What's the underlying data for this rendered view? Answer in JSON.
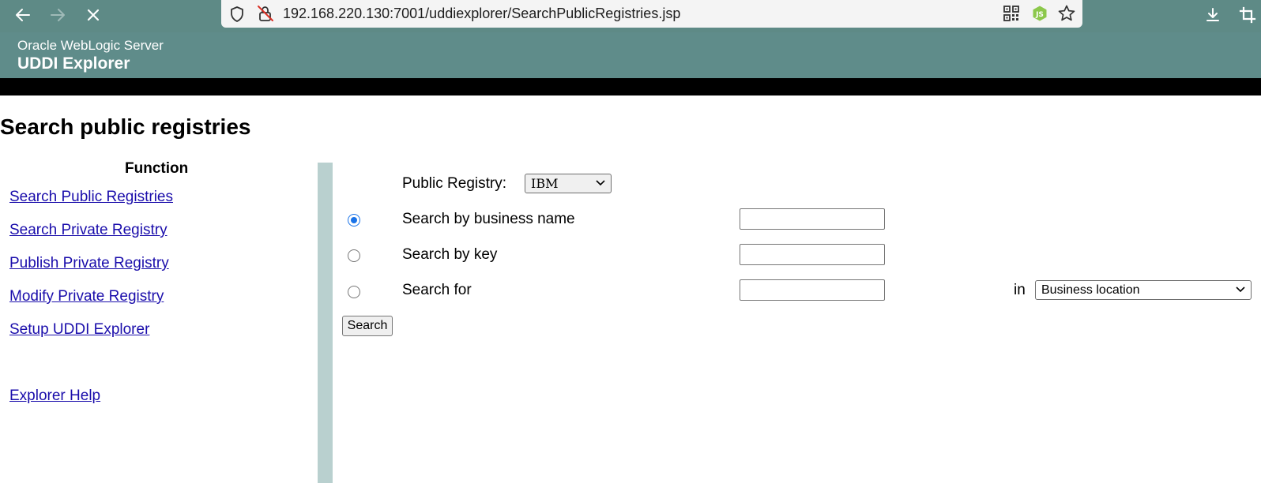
{
  "browser": {
    "url": "192.168.220.130:7001/uddiexplorer/SearchPublicRegistries.jsp",
    "toolbar_icons": [
      "back-icon",
      "forward-icon",
      "stop-icon",
      "shield-icon",
      "insecure-lock-icon",
      "qr-code-icon",
      "nodejs-extension-icon",
      "bookmark-star-icon",
      "download-icon",
      "crop-icon"
    ]
  },
  "header": {
    "subtitle": "Oracle WebLogic Server",
    "title": "UDDI Explorer"
  },
  "page": {
    "heading": "Search public registries"
  },
  "sidebar": {
    "title": "Function",
    "links": [
      {
        "label": "Search Public Registries"
      },
      {
        "label": "Search Private Registry"
      },
      {
        "label": "Publish Private Registry"
      },
      {
        "label": "Modify Private Registry"
      },
      {
        "label": "Setup UDDI Explorer"
      },
      {
        "label": "Explorer Help"
      }
    ]
  },
  "form": {
    "registry_label": "Public Registry:",
    "registry_value": "IBM",
    "options": [
      {
        "label": "Search by business name",
        "selected": true,
        "value": ""
      },
      {
        "label": "Search by key",
        "selected": false,
        "value": ""
      },
      {
        "label": "Search for",
        "selected": false,
        "value": ""
      }
    ],
    "in_label": "in",
    "search_for_scope": "Business location",
    "search_button": "Search"
  },
  "colors": {
    "browser_bar": "#5e8a86",
    "header_bg": "#5f8c8a",
    "divider": "#b9d0cf",
    "link": "#1a0dab",
    "radio_selected": "#1a73e8"
  }
}
